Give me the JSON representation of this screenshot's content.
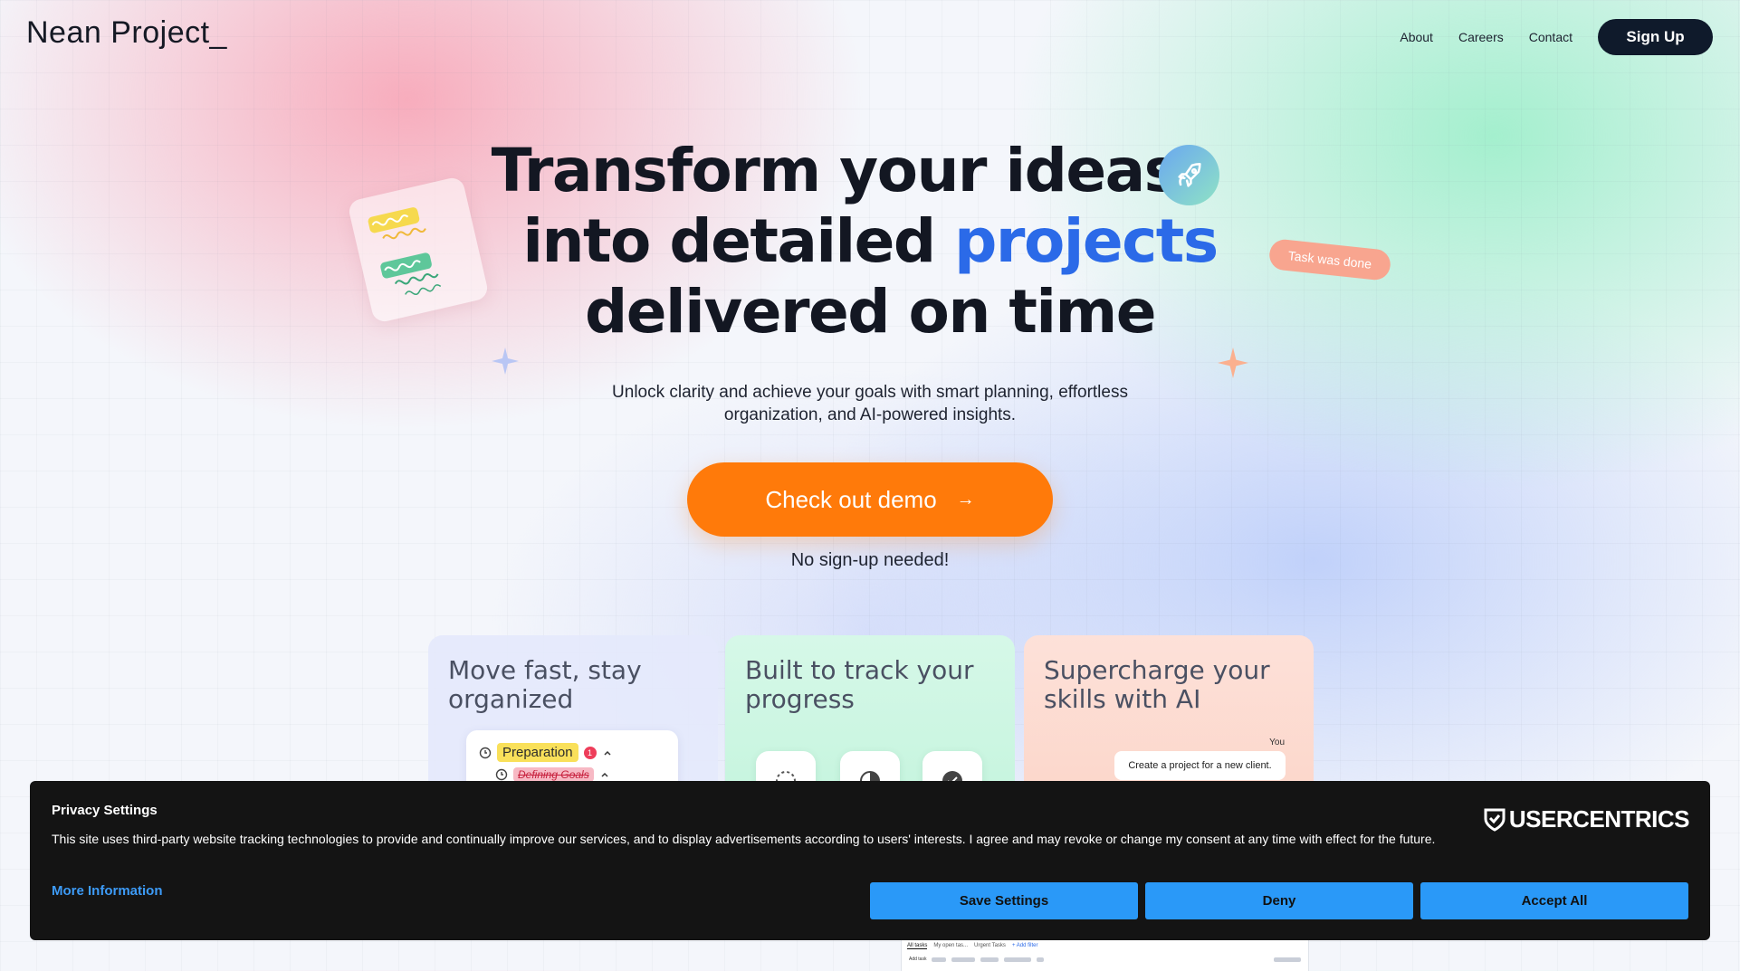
{
  "header": {
    "logo": "Nean Project_",
    "nav": [
      "About",
      "Careers",
      "Contact"
    ],
    "signup_label": "Sign Up"
  },
  "hero": {
    "line1": "Transform your ideas",
    "line2_prefix": "into detailed ",
    "line2_accent": "projects",
    "line3": "delivered on time",
    "subtitle_line1": "Unlock clarity and achieve your goals with smart planning, effortless",
    "subtitle_line2": "organization, and AI-powered insights.",
    "cta_label": "Check out demo",
    "cta_arrow": "→",
    "note": "No sign-up needed!",
    "task_pill": "Task was done",
    "accent_color": "#2b6ae8",
    "cta_color": "#ff7a0a"
  },
  "cards": [
    {
      "title": "Move fast, stay organized",
      "prep_label": "Preparation",
      "prep_count": "1",
      "goal_label": "Defining Goals"
    },
    {
      "title": "Built to track your progress"
    },
    {
      "title": "Supercharge your skills with AI",
      "you_label": "You",
      "chat_message": "Create a project for a new client."
    }
  ],
  "app_peek": {
    "tabs": [
      "All tasks",
      "My open tas...",
      "Urgent Tasks",
      "+ Add filter"
    ],
    "add_task": "Add task"
  },
  "privacy": {
    "title": "Privacy Settings",
    "text": "This site uses third-party website tracking technologies to provide and continually improve our services, and to display advertisements according to users' interests. I agree and may revoke or change my consent at any time with effect for the future.",
    "more_info": "More Information",
    "brand": "USERCENTRICS",
    "save_label": "Save Settings",
    "deny_label": "Deny",
    "accept_label": "Accept All",
    "button_color": "#2a99f8"
  }
}
